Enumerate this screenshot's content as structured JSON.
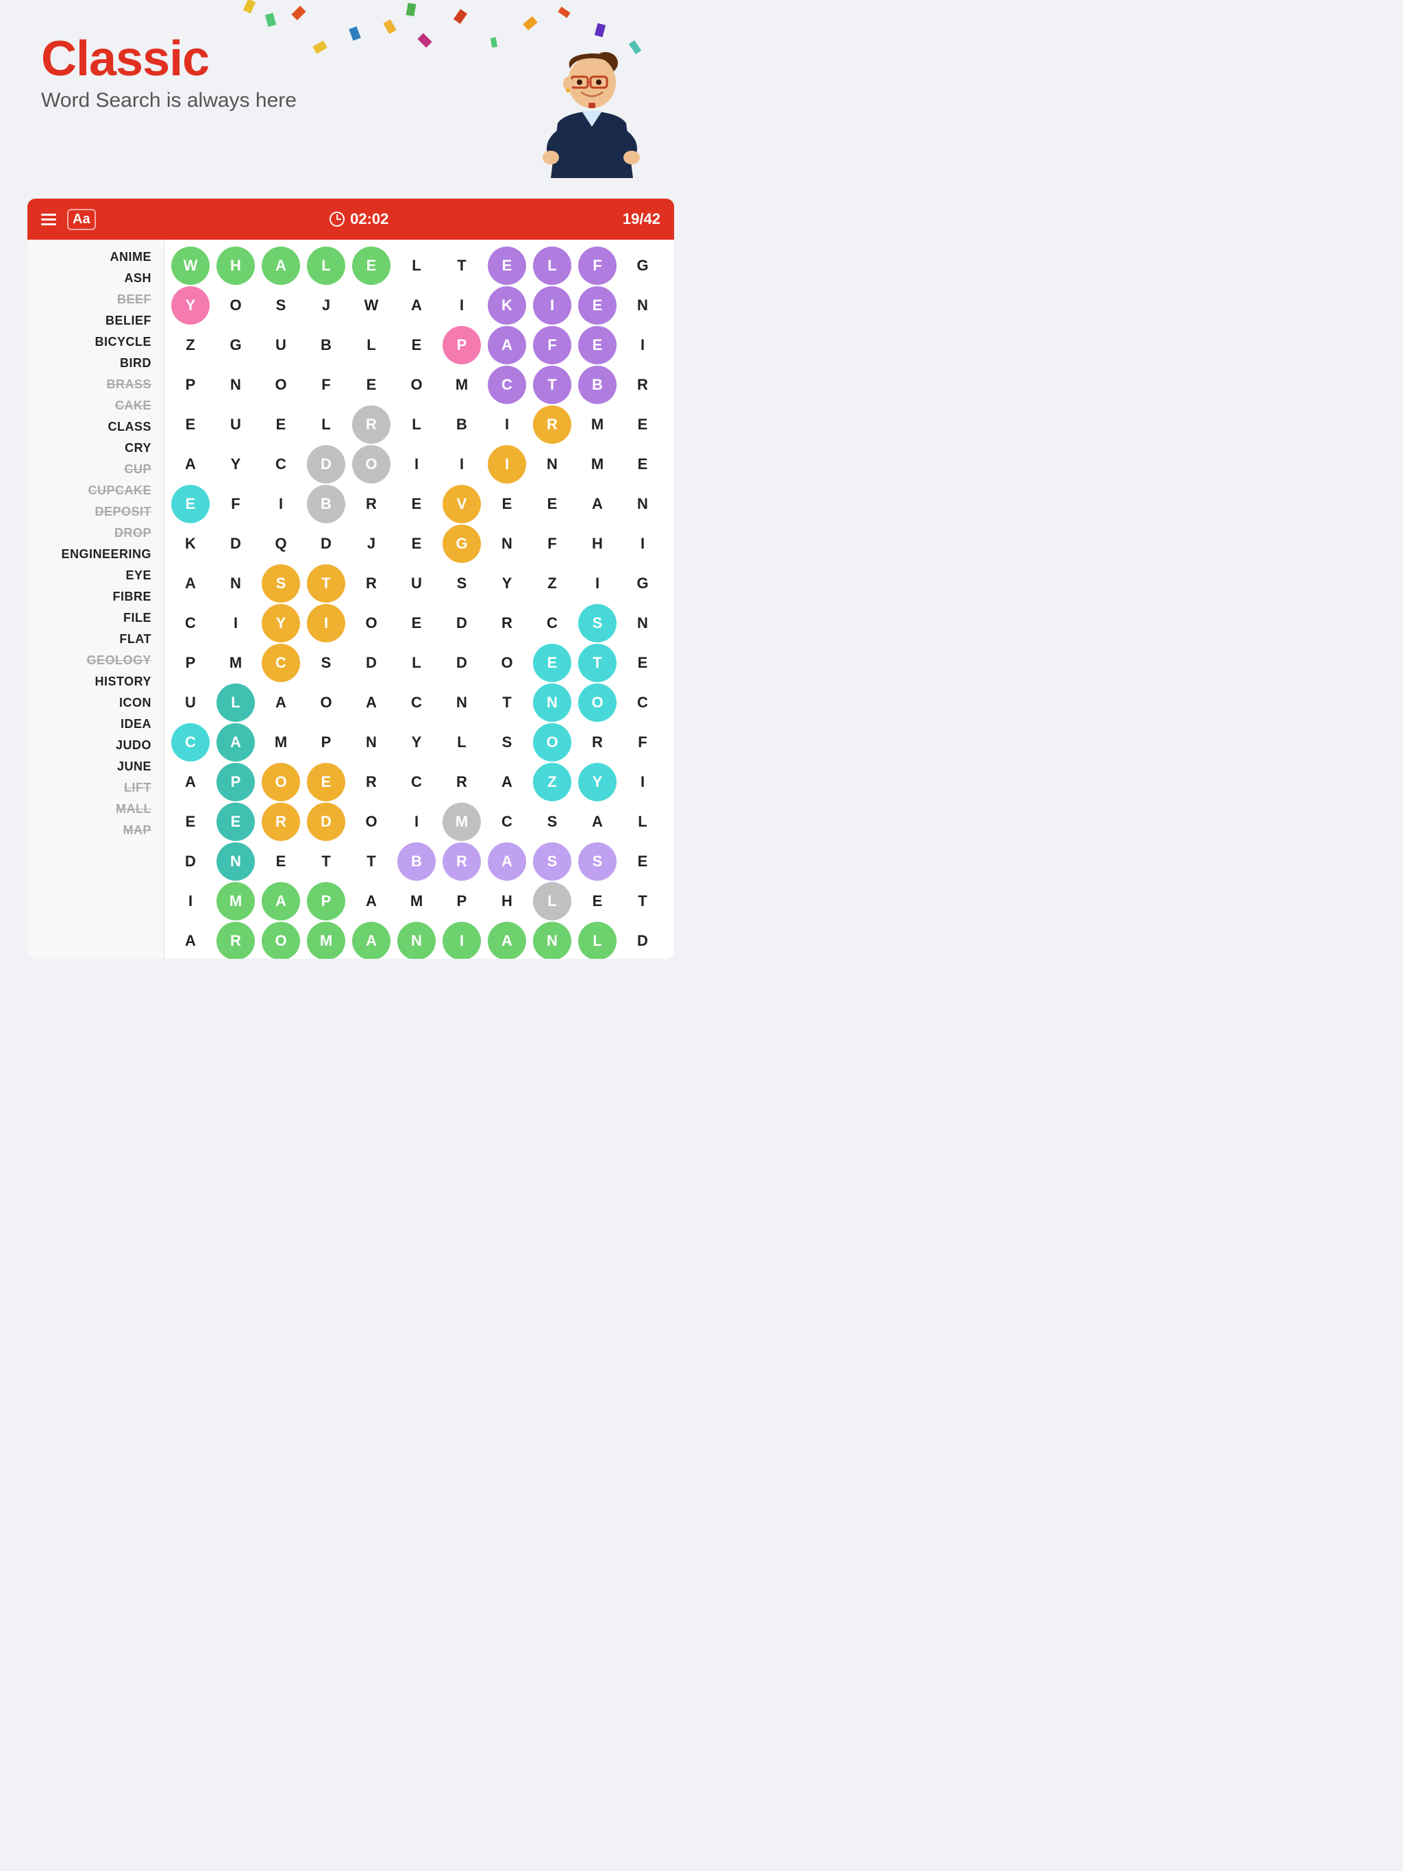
{
  "app": {
    "title": "Classic",
    "subtitle": "Word Search is always here"
  },
  "toolbar": {
    "time": "02:02",
    "progress": "19/42",
    "hamburger_label": "Menu",
    "font_label": "Aa"
  },
  "words": [
    {
      "text": "ANIME",
      "found": false
    },
    {
      "text": "ASH",
      "found": false
    },
    {
      "text": "BEEF",
      "found": true
    },
    {
      "text": "BELIEF",
      "found": false
    },
    {
      "text": "BICYCLE",
      "found": false
    },
    {
      "text": "BIRD",
      "found": false
    },
    {
      "text": "BRASS",
      "found": true
    },
    {
      "text": "CAKE",
      "found": true
    },
    {
      "text": "CLASS",
      "found": false
    },
    {
      "text": "CRY",
      "found": false
    },
    {
      "text": "CUP",
      "found": true
    },
    {
      "text": "CUPCAKE",
      "found": true
    },
    {
      "text": "DEPOSIT",
      "found": true
    },
    {
      "text": "DROP",
      "found": true
    },
    {
      "text": "ENGINEERING",
      "found": false
    },
    {
      "text": "EYE",
      "found": false
    },
    {
      "text": "FIBRE",
      "found": false
    },
    {
      "text": "FILE",
      "found": false
    },
    {
      "text": "FLAT",
      "found": false
    },
    {
      "text": "GEOLOGY",
      "found": true
    },
    {
      "text": "HISTORY",
      "found": false
    },
    {
      "text": "ICON",
      "found": false
    },
    {
      "text": "IDEA",
      "found": false
    },
    {
      "text": "JUDO",
      "found": false
    },
    {
      "text": "JUNE",
      "found": false
    },
    {
      "text": "LIFT",
      "found": true
    },
    {
      "text": "MALL",
      "found": true
    },
    {
      "text": "MAP",
      "found": true
    }
  ],
  "grid": [
    [
      {
        "letter": "W",
        "hl": "green"
      },
      {
        "letter": "H",
        "hl": "green"
      },
      {
        "letter": "A",
        "hl": "green"
      },
      {
        "letter": "L",
        "hl": "green"
      },
      {
        "letter": "E",
        "hl": "green"
      },
      {
        "letter": "L",
        "hl": ""
      },
      {
        "letter": "T",
        "hl": ""
      },
      {
        "letter": "E",
        "hl": "purple"
      },
      {
        "letter": "L",
        "hl": "purple"
      },
      {
        "letter": "F",
        "hl": "purple"
      },
      {
        "letter": "G",
        "hl": ""
      }
    ],
    [
      {
        "letter": "Y",
        "hl": "pink"
      },
      {
        "letter": "O",
        "hl": ""
      },
      {
        "letter": "S",
        "hl": ""
      },
      {
        "letter": "J",
        "hl": ""
      },
      {
        "letter": "W",
        "hl": ""
      },
      {
        "letter": "A",
        "hl": ""
      },
      {
        "letter": "I",
        "hl": ""
      },
      {
        "letter": "K",
        "hl": "purple"
      },
      {
        "letter": "I",
        "hl": "purple"
      },
      {
        "letter": "E",
        "hl": "purple"
      },
      {
        "letter": "N",
        "hl": ""
      }
    ],
    [
      {
        "letter": "Z",
        "hl": ""
      },
      {
        "letter": "G",
        "hl": ""
      },
      {
        "letter": "U",
        "hl": ""
      },
      {
        "letter": "B",
        "hl": ""
      },
      {
        "letter": "L",
        "hl": ""
      },
      {
        "letter": "E",
        "hl": ""
      },
      {
        "letter": "P",
        "hl": "pink"
      },
      {
        "letter": "A",
        "hl": "purple"
      },
      {
        "letter": "F",
        "hl": "purple"
      },
      {
        "letter": "E",
        "hl": "purple"
      },
      {
        "letter": "I",
        "hl": ""
      }
    ],
    [
      {
        "letter": "P",
        "hl": ""
      },
      {
        "letter": "N",
        "hl": ""
      },
      {
        "letter": "O",
        "hl": ""
      },
      {
        "letter": "F",
        "hl": ""
      },
      {
        "letter": "E",
        "hl": ""
      },
      {
        "letter": "O",
        "hl": ""
      },
      {
        "letter": "M",
        "hl": ""
      },
      {
        "letter": "C",
        "hl": "purple"
      },
      {
        "letter": "T",
        "hl": "purple"
      },
      {
        "letter": "B",
        "hl": "purple"
      },
      {
        "letter": "R",
        "hl": ""
      }
    ],
    [
      {
        "letter": "E",
        "hl": ""
      },
      {
        "letter": "U",
        "hl": ""
      },
      {
        "letter": "E",
        "hl": ""
      },
      {
        "letter": "L",
        "hl": ""
      },
      {
        "letter": "R",
        "hl": "gray"
      },
      {
        "letter": "L",
        "hl": ""
      },
      {
        "letter": "B",
        "hl": ""
      },
      {
        "letter": "I",
        "hl": ""
      },
      {
        "letter": "R",
        "hl": "orange"
      },
      {
        "letter": "M",
        "hl": ""
      },
      {
        "letter": "E",
        "hl": ""
      }
    ],
    [
      {
        "letter": "A",
        "hl": ""
      },
      {
        "letter": "Y",
        "hl": ""
      },
      {
        "letter": "C",
        "hl": ""
      },
      {
        "letter": "D",
        "hl": "gray"
      },
      {
        "letter": "O",
        "hl": "gray"
      },
      {
        "letter": "I",
        "hl": ""
      },
      {
        "letter": "I",
        "hl": ""
      },
      {
        "letter": "I",
        "hl": "orange"
      },
      {
        "letter": "N",
        "hl": ""
      },
      {
        "letter": "M",
        "hl": ""
      },
      {
        "letter": "E",
        "hl": ""
      }
    ],
    [
      {
        "letter": "E",
        "hl": "cyan"
      },
      {
        "letter": "F",
        "hl": ""
      },
      {
        "letter": "I",
        "hl": ""
      },
      {
        "letter": "B",
        "hl": "gray"
      },
      {
        "letter": "R",
        "hl": ""
      },
      {
        "letter": "E",
        "hl": ""
      },
      {
        "letter": "V",
        "hl": "orange"
      },
      {
        "letter": "E",
        "hl": ""
      },
      {
        "letter": "E",
        "hl": ""
      },
      {
        "letter": "A",
        "hl": ""
      },
      {
        "letter": "N",
        "hl": ""
      }
    ],
    [
      {
        "letter": "K",
        "hl": ""
      },
      {
        "letter": "D",
        "hl": ""
      },
      {
        "letter": "Q",
        "hl": ""
      },
      {
        "letter": "D",
        "hl": ""
      },
      {
        "letter": "J",
        "hl": ""
      },
      {
        "letter": "E",
        "hl": ""
      },
      {
        "letter": "G",
        "hl": "orange"
      },
      {
        "letter": "N",
        "hl": ""
      },
      {
        "letter": "F",
        "hl": ""
      },
      {
        "letter": "H",
        "hl": ""
      },
      {
        "letter": "I",
        "hl": ""
      }
    ],
    [
      {
        "letter": "A",
        "hl": ""
      },
      {
        "letter": "N",
        "hl": ""
      },
      {
        "letter": "S",
        "hl": "orange"
      },
      {
        "letter": "T",
        "hl": "orange"
      },
      {
        "letter": "R",
        "hl": ""
      },
      {
        "letter": "U",
        "hl": ""
      },
      {
        "letter": "S",
        "hl": ""
      },
      {
        "letter": "Y",
        "hl": ""
      },
      {
        "letter": "Z",
        "hl": ""
      },
      {
        "letter": "I",
        "hl": ""
      },
      {
        "letter": "G",
        "hl": ""
      }
    ],
    [
      {
        "letter": "C",
        "hl": ""
      },
      {
        "letter": "I",
        "hl": ""
      },
      {
        "letter": "Y",
        "hl": "orange"
      },
      {
        "letter": "I",
        "hl": "orange"
      },
      {
        "letter": "O",
        "hl": ""
      },
      {
        "letter": "E",
        "hl": ""
      },
      {
        "letter": "D",
        "hl": ""
      },
      {
        "letter": "R",
        "hl": ""
      },
      {
        "letter": "C",
        "hl": ""
      },
      {
        "letter": "S",
        "hl": "cyan"
      },
      {
        "letter": "N",
        "hl": ""
      }
    ],
    [
      {
        "letter": "P",
        "hl": ""
      },
      {
        "letter": "M",
        "hl": ""
      },
      {
        "letter": "C",
        "hl": "orange"
      },
      {
        "letter": "S",
        "hl": ""
      },
      {
        "letter": "D",
        "hl": ""
      },
      {
        "letter": "L",
        "hl": ""
      },
      {
        "letter": "D",
        "hl": ""
      },
      {
        "letter": "O",
        "hl": ""
      },
      {
        "letter": "E",
        "hl": "cyan"
      },
      {
        "letter": "T",
        "hl": "cyan"
      },
      {
        "letter": "E",
        "hl": ""
      }
    ],
    [
      {
        "letter": "U",
        "hl": ""
      },
      {
        "letter": "L",
        "hl": "teal"
      },
      {
        "letter": "A",
        "hl": ""
      },
      {
        "letter": "O",
        "hl": ""
      },
      {
        "letter": "A",
        "hl": ""
      },
      {
        "letter": "C",
        "hl": ""
      },
      {
        "letter": "N",
        "hl": ""
      },
      {
        "letter": "T",
        "hl": ""
      },
      {
        "letter": "N",
        "hl": "cyan"
      },
      {
        "letter": "O",
        "hl": "cyan"
      },
      {
        "letter": "C",
        "hl": ""
      }
    ],
    [
      {
        "letter": "C",
        "hl": "cyan"
      },
      {
        "letter": "A",
        "hl": "teal"
      },
      {
        "letter": "M",
        "hl": ""
      },
      {
        "letter": "P",
        "hl": ""
      },
      {
        "letter": "N",
        "hl": ""
      },
      {
        "letter": "Y",
        "hl": ""
      },
      {
        "letter": "L",
        "hl": ""
      },
      {
        "letter": "S",
        "hl": ""
      },
      {
        "letter": "O",
        "hl": "cyan"
      },
      {
        "letter": "R",
        "hl": ""
      },
      {
        "letter": "F",
        "hl": ""
      }
    ],
    [
      {
        "letter": "A",
        "hl": ""
      },
      {
        "letter": "P",
        "hl": "teal"
      },
      {
        "letter": "O",
        "hl": "orange"
      },
      {
        "letter": "E",
        "hl": "orange"
      },
      {
        "letter": "R",
        "hl": ""
      },
      {
        "letter": "C",
        "hl": ""
      },
      {
        "letter": "R",
        "hl": ""
      },
      {
        "letter": "A",
        "hl": ""
      },
      {
        "letter": "Z",
        "hl": "cyan"
      },
      {
        "letter": "Y",
        "hl": "cyan"
      },
      {
        "letter": "I",
        "hl": ""
      }
    ],
    [
      {
        "letter": "E",
        "hl": ""
      },
      {
        "letter": "E",
        "hl": "teal"
      },
      {
        "letter": "R",
        "hl": "orange"
      },
      {
        "letter": "D",
        "hl": "orange"
      },
      {
        "letter": "O",
        "hl": ""
      },
      {
        "letter": "I",
        "hl": ""
      },
      {
        "letter": "M",
        "hl": "gray"
      },
      {
        "letter": "C",
        "hl": ""
      },
      {
        "letter": "S",
        "hl": ""
      },
      {
        "letter": "A",
        "hl": ""
      },
      {
        "letter": "L",
        "hl": ""
      }
    ],
    [
      {
        "letter": "D",
        "hl": ""
      },
      {
        "letter": "N",
        "hl": "teal"
      },
      {
        "letter": "E",
        "hl": ""
      },
      {
        "letter": "T",
        "hl": ""
      },
      {
        "letter": "T",
        "hl": ""
      },
      {
        "letter": "B",
        "hl": "lavender"
      },
      {
        "letter": "R",
        "hl": "lavender"
      },
      {
        "letter": "A",
        "hl": "lavender"
      },
      {
        "letter": "S",
        "hl": "lavender"
      },
      {
        "letter": "S",
        "hl": "lavender"
      },
      {
        "letter": "E",
        "hl": ""
      }
    ],
    [
      {
        "letter": "I",
        "hl": ""
      },
      {
        "letter": "M",
        "hl": "green"
      },
      {
        "letter": "A",
        "hl": "green"
      },
      {
        "letter": "P",
        "hl": "green"
      },
      {
        "letter": "A",
        "hl": ""
      },
      {
        "letter": "M",
        "hl": ""
      },
      {
        "letter": "P",
        "hl": ""
      },
      {
        "letter": "H",
        "hl": ""
      },
      {
        "letter": "L",
        "hl": "gray"
      },
      {
        "letter": "E",
        "hl": ""
      },
      {
        "letter": "T",
        "hl": ""
      }
    ],
    [
      {
        "letter": "A",
        "hl": ""
      },
      {
        "letter": "R",
        "hl": "green"
      },
      {
        "letter": "O",
        "hl": "green"
      },
      {
        "letter": "M",
        "hl": "green"
      },
      {
        "letter": "A",
        "hl": "green"
      },
      {
        "letter": "N",
        "hl": "green"
      },
      {
        "letter": "I",
        "hl": "green"
      },
      {
        "letter": "A",
        "hl": "green"
      },
      {
        "letter": "N",
        "hl": "green"
      },
      {
        "letter": "L",
        "hl": "green"
      },
      {
        "letter": "D",
        "hl": ""
      }
    ]
  ]
}
